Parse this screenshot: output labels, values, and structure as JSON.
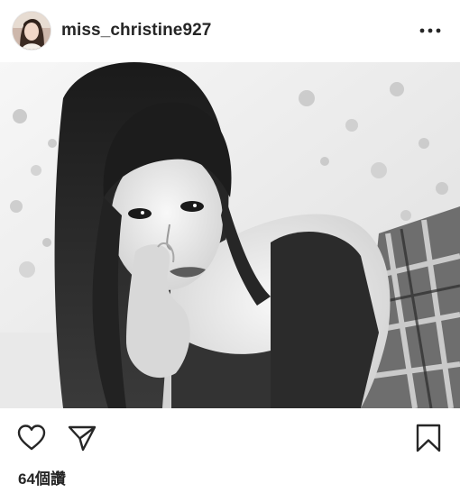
{
  "post": {
    "username": "miss_christine927",
    "likes_text": "64個讚"
  },
  "icons": {
    "avatar": "profile-photo",
    "more": "more-options-icon",
    "like": "heart-icon",
    "share": "paper-plane-icon",
    "save": "bookmark-icon"
  },
  "colors": {
    "text": "#262626",
    "icon": "#262626",
    "background": "#ffffff"
  }
}
